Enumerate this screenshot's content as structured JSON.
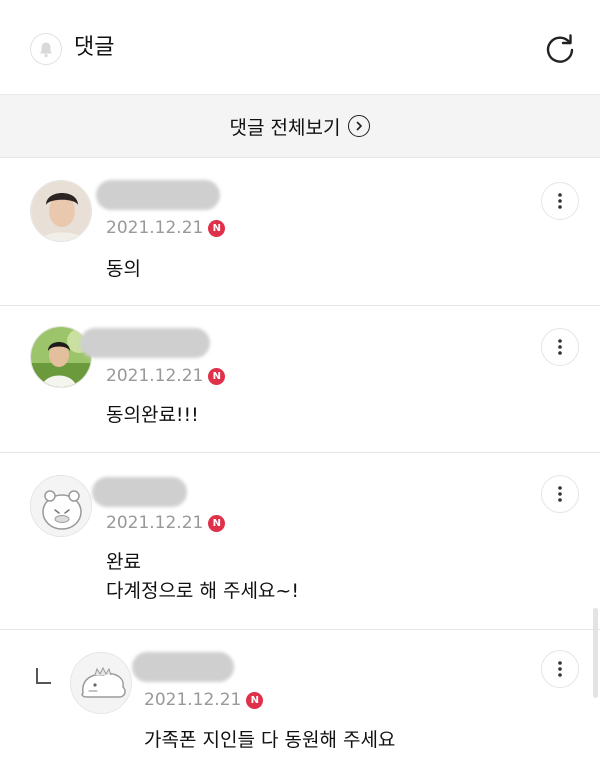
{
  "header": {
    "title": "댓글",
    "bell_icon": "bell-icon",
    "refresh_icon": "refresh-icon"
  },
  "view_all": {
    "label": "댓글 전체보기",
    "icon": "chevron-right-circle-icon"
  },
  "comments": [
    {
      "date": "2021.12.21",
      "badge": "N",
      "lines": [
        "동의"
      ]
    },
    {
      "date": "2021.12.21",
      "badge": "N",
      "lines": [
        "동의완료!!!"
      ]
    },
    {
      "date": "2021.12.21",
      "badge": "N",
      "lines": [
        "완료",
        "다계정으로 해 주세요~!"
      ]
    },
    {
      "date": "2021.12.21",
      "badge": "N",
      "lines": [
        "가족폰 지인들 다 동원해 주세요"
      ],
      "is_reply": true
    }
  ],
  "colors": {
    "badge": "#e0314b",
    "meta_text": "#999999",
    "view_all_bg": "#f4f4f4"
  }
}
